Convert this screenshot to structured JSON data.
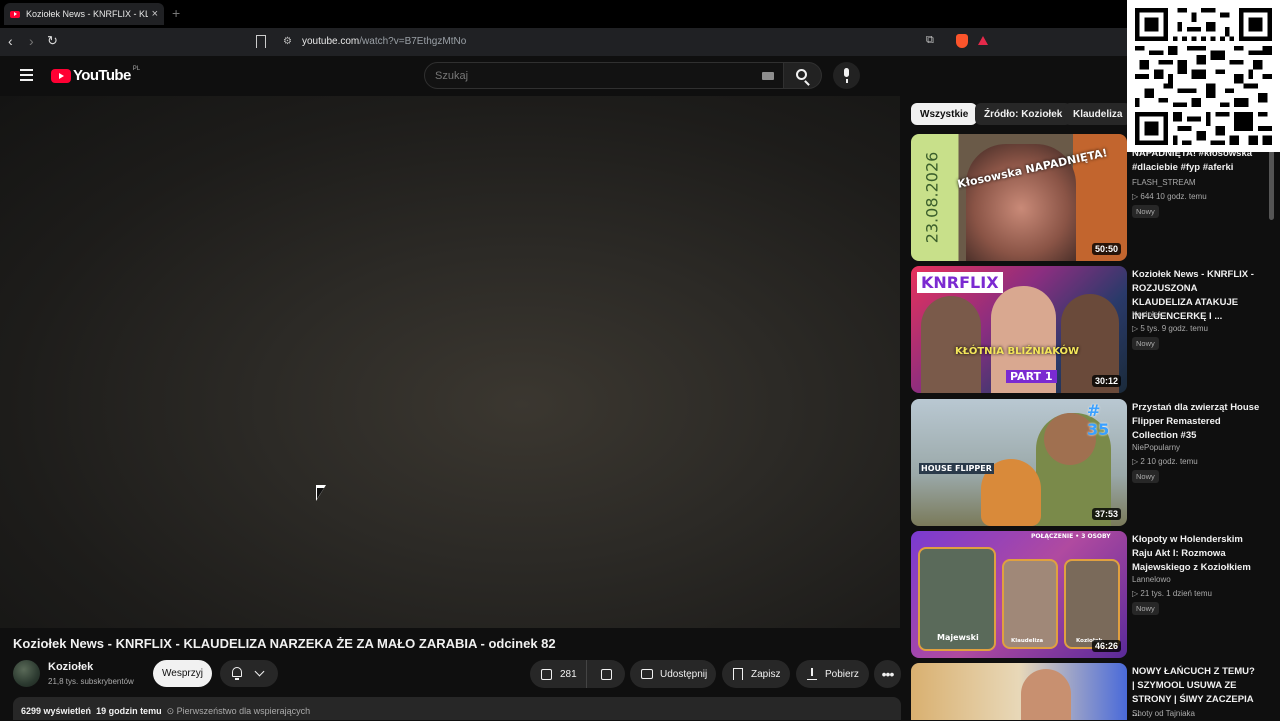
{
  "browser": {
    "tab_title": "Koziołek News - KNRFLIX - KLAUDELIZA NARZEKA ŻE ZA MAŁO ZARABIA",
    "url_main": "youtube.com",
    "url_path": "/watch?v=B7EthgzMtNo"
  },
  "masthead": {
    "logo_text": "YouTube",
    "region": "PL",
    "search_placeholder": "Szukaj"
  },
  "video": {
    "title": "Koziołek News - KNRFLIX - KLAUDELIZA NARZEKA ŻE ZA MAŁO ZARABIA - odcinek 82",
    "channel_name": "Koziołek",
    "subscribers": "21,8 tys. subskrybentów",
    "support_label": "Wesprzyj",
    "likes": "281",
    "share_label": "Udostępnij",
    "save_label": "Zapisz",
    "download_label": "Pobierz",
    "more_label": "•••",
    "views": "6299 wyświetleń",
    "uploaded": "19 godzin temu",
    "supporters": "⊙ Pierwszeństwo dla wspierających"
  },
  "chips": [
    "Wszystkie",
    "Źródło: Koziołek",
    "Klaudeliza"
  ],
  "sidebar": [
    {
      "title": "NAPADNIĘTA! #kłosowska #dlaciebie #fyp #aferki",
      "channel": "FLASH_STREAM",
      "meta": "▷ 644  10 godz. temu",
      "badge": "Nowy",
      "duration": "50:50",
      "thumb_date": "23.08.2026",
      "thumb_caption": "Kłosowska NAPADNIĘTA!"
    },
    {
      "title": "Koziołek News - KNRFLIX - ROZJUSZONA KLAUDELIZA ATAKUJE INFLUENCERKĘ I ...",
      "channel": "Koziołek",
      "meta": "▷ 5 tys.  9 godz. temu",
      "badge": "Nowy",
      "duration": "30:12",
      "thumb_brand": "KNRFLIX",
      "thumb_caption": "KŁÓTNIA BLIŹNIAKÓW",
      "thumb_part": "PART 1"
    },
    {
      "title": "Przystań dla zwierząt House Flipper Remastered Collection #35",
      "channel": "NiePopularny",
      "meta": "▷ 2  10 godz. temu",
      "badge": "Nowy",
      "duration": "37:53",
      "thumb_num": "# 35",
      "thumb_game": "HOUSE FLIPPER"
    },
    {
      "title": "Kłopoty w Holenderskim Raju Akt I: Rozmowa Majewskiego z Koziołkiem",
      "channel": "Lannelowo",
      "meta": "▷ 21 tys.  1 dzień temu",
      "badge": "Nowy",
      "duration": "46:26",
      "thumb_names": [
        "Majewski",
        "Klaudeliza",
        "Koziołek"
      ],
      "thumb_tag": "POŁĄCZENIE • 3 OSOBY"
    },
    {
      "title": "NOWY ŁAŃCUCH Z TEMU? | SZYMOOL USUWA ZE STRONY | ŚIWY ZACZEPIA ...",
      "channel": "Shoty od Tajniaka"
    }
  ]
}
